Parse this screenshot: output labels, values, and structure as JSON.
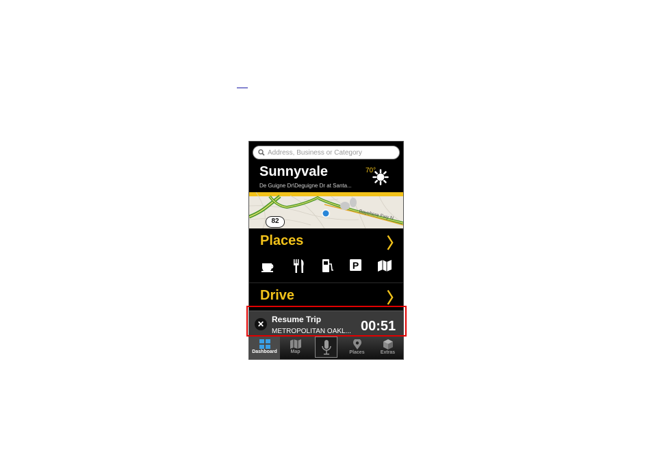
{
  "search": {
    "placeholder": "Address, Business or Category"
  },
  "location": {
    "city": "Sunnyvale",
    "address": "De Guigne Dr\\Deguigne Dr at Santa..."
  },
  "weather": {
    "temp": "70°",
    "icon": "sun-icon"
  },
  "map": {
    "route_shield": "82",
    "road_label": "Bayshore Fwy N"
  },
  "places": {
    "title": "Places",
    "icons": [
      "coffee-icon",
      "restaurant-icon",
      "gas-icon",
      "parking-icon",
      "map-icon"
    ]
  },
  "drive": {
    "title": "Drive"
  },
  "trip": {
    "title": "Resume Trip",
    "destination": "METROPOLITAN OAKL...",
    "time": "00:51"
  },
  "tabs": [
    {
      "label": "Dashboard",
      "icon": "dashboard-icon",
      "active": true
    },
    {
      "label": "Map",
      "icon": "map-icon"
    },
    {
      "label": "",
      "icon": "microphone-icon"
    },
    {
      "label": "Places",
      "icon": "places-pin-icon"
    },
    {
      "label": "Extras",
      "icon": "extras-cube-icon"
    }
  ],
  "colors": {
    "accent": "#f2c21a",
    "highlight": "#e00000"
  }
}
